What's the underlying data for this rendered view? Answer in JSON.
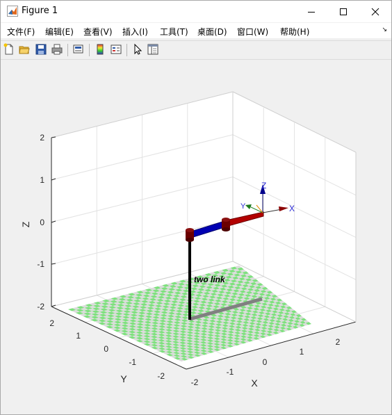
{
  "window": {
    "title": "Figure 1",
    "controls": [
      "minimize-icon",
      "maximize-icon",
      "close-icon"
    ]
  },
  "menu": [
    {
      "label": "文件(F)"
    },
    {
      "label": "编辑(E)"
    },
    {
      "label": "查看(V)"
    },
    {
      "label": "插入(I)"
    },
    {
      "label": "工具(T)"
    },
    {
      "label": "桌面(D)"
    },
    {
      "label": "窗口(W)"
    },
    {
      "label": "帮助(H)"
    }
  ],
  "toolbar": [
    "new-figure-icon",
    "open-file-icon",
    "save-icon",
    "print-icon",
    "link-plot-icon",
    "insert-colorbar-icon",
    "insert-legend-icon",
    "edit-plot-arrow-icon",
    "property-inspector-icon"
  ],
  "plot": {
    "xlabel": "X",
    "ylabel": "Y",
    "zlabel": "Z",
    "xticks": [
      "-2",
      "-1",
      "0",
      "1",
      "2"
    ],
    "yticks": [
      "-2",
      "-1",
      "0",
      "1",
      "2"
    ],
    "zticks": [
      "-2",
      "-1",
      "0",
      "1",
      "2"
    ],
    "robot_name": "two link",
    "frame_labels": {
      "x": "X",
      "y": "Y",
      "z": "Z"
    },
    "colors": {
      "link1": "#0000b3",
      "link2": "#b30000",
      "joint": "#6b0000",
      "floor_a": "#7ee07e",
      "floor_b": "#dcdcdc",
      "shadow": "#808080"
    }
  }
}
